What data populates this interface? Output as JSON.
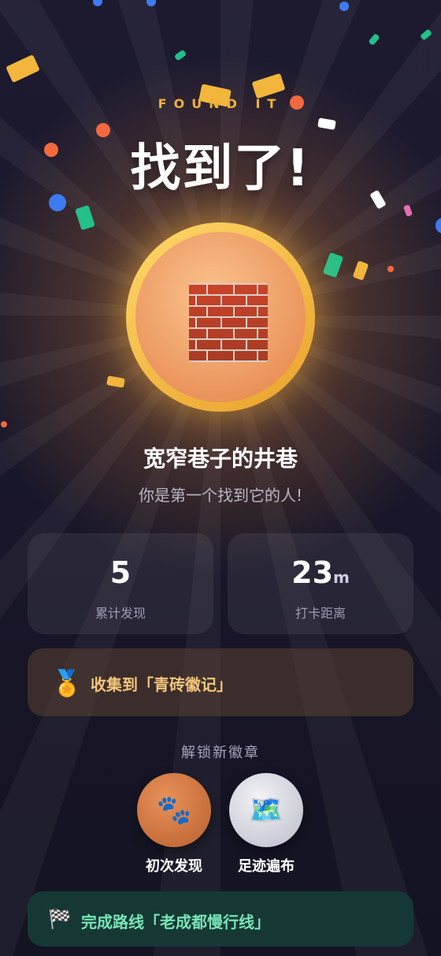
{
  "header": {
    "eyebrow": "FOUND IT",
    "headline": "找到了!"
  },
  "medal": {
    "icon": "brick-wall-icon"
  },
  "place": {
    "name": "宽窄巷子的井巷",
    "subtitle": "你是第一个找到它的人!"
  },
  "stats": [
    {
      "value": "5",
      "unit": "",
      "label": "累计发现"
    },
    {
      "value": "23",
      "unit": "m",
      "label": "打卡距离"
    }
  ],
  "collection": {
    "icon": "medal-icon",
    "text": "收集到「青砖徽记」"
  },
  "badges": {
    "title": "解锁新徽章",
    "items": [
      {
        "icon": "paw-prints-icon",
        "label": "初次发现"
      },
      {
        "icon": "map-icon",
        "label": "足迹遍布"
      }
    ]
  },
  "route": {
    "icon": "checkered-flag-icon",
    "text": "完成路线「老成都慢行线」"
  },
  "colors": {
    "accent_gold": "#f0b13a",
    "collect_text": "#f3c57b",
    "route_text": "#78e4b6",
    "background": "#181628"
  }
}
